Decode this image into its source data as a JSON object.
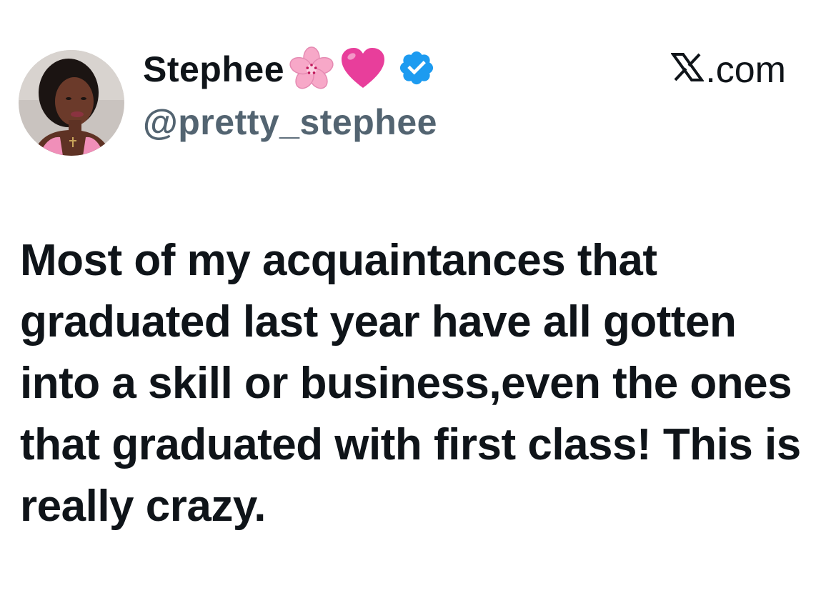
{
  "tweet": {
    "author": {
      "display_name": "Stephee",
      "emojis": [
        "cherry-blossom-emoji",
        "pink-heart-emoji"
      ],
      "verified": true,
      "handle": "@pretty_stephee",
      "avatar": "profile-photo"
    },
    "source": {
      "logo": "x-logo",
      "label": ".com"
    },
    "text": "Most of my acquaintances that graduated last year have all gotten into a skill or business,even the ones that graduated with first class! This is really crazy."
  },
  "colors": {
    "text_primary": "#0f1419",
    "text_secondary": "#536471",
    "verified_blue": "#1d9bf0",
    "heart_pink": "#e83e9b",
    "blossom_pink": "#f7a8c8"
  }
}
